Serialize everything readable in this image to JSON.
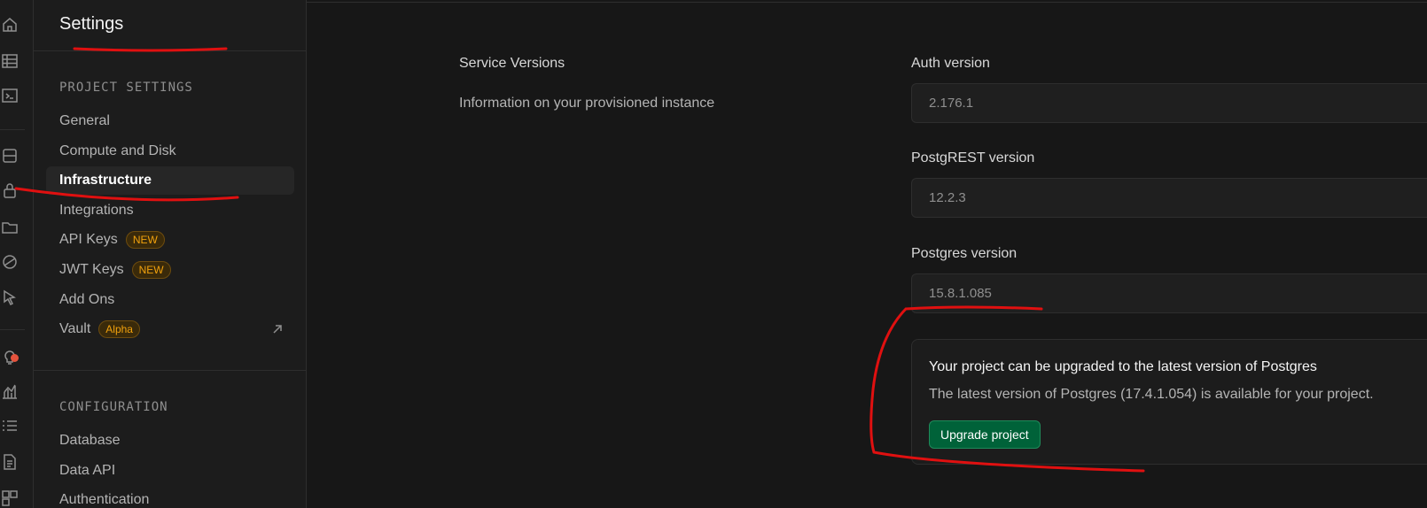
{
  "sidebar": {
    "title": "Settings",
    "project_section_label": "PROJECT SETTINGS",
    "project_items": [
      {
        "label": "General"
      },
      {
        "label": "Compute and Disk"
      },
      {
        "label": "Infrastructure"
      },
      {
        "label": "Integrations"
      },
      {
        "label": "API Keys",
        "badge": "NEW"
      },
      {
        "label": "JWT Keys",
        "badge": "NEW"
      },
      {
        "label": "Add Ons"
      },
      {
        "label": "Vault",
        "badge": "Alpha"
      }
    ],
    "config_section_label": "CONFIGURATION",
    "config_items": [
      {
        "label": "Database"
      },
      {
        "label": "Data API"
      },
      {
        "label": "Authentication"
      }
    ]
  },
  "rail_icons": [
    "home-icon",
    "table-editor-icon",
    "sql-editor-icon",
    "database-icon",
    "auth-icon",
    "storage-icon",
    "edge-functions-icon",
    "realtime-icon",
    "advisors-icon",
    "reports-icon",
    "logs-icon",
    "docs-icon",
    "integrations-icon"
  ],
  "main": {
    "section_title": "Service Versions",
    "section_desc": "Information on your provisioned instance",
    "fields": [
      {
        "label": "Auth version",
        "value": "2.176.1"
      },
      {
        "label": "PostgREST version",
        "value": "12.2.3"
      },
      {
        "label": "Postgres version",
        "value": "15.8.1.085"
      }
    ],
    "alert": {
      "title": "Your project can be upgraded to the latest version of Postgres",
      "body": "The latest version of Postgres (17.4.1.054) is available for your project.",
      "button_label": "Upgrade project"
    }
  },
  "colors": {
    "background": "#171717",
    "accent_green": "#006239",
    "badge_orange": "#f1a10d",
    "annotation_red": "#e01010"
  }
}
